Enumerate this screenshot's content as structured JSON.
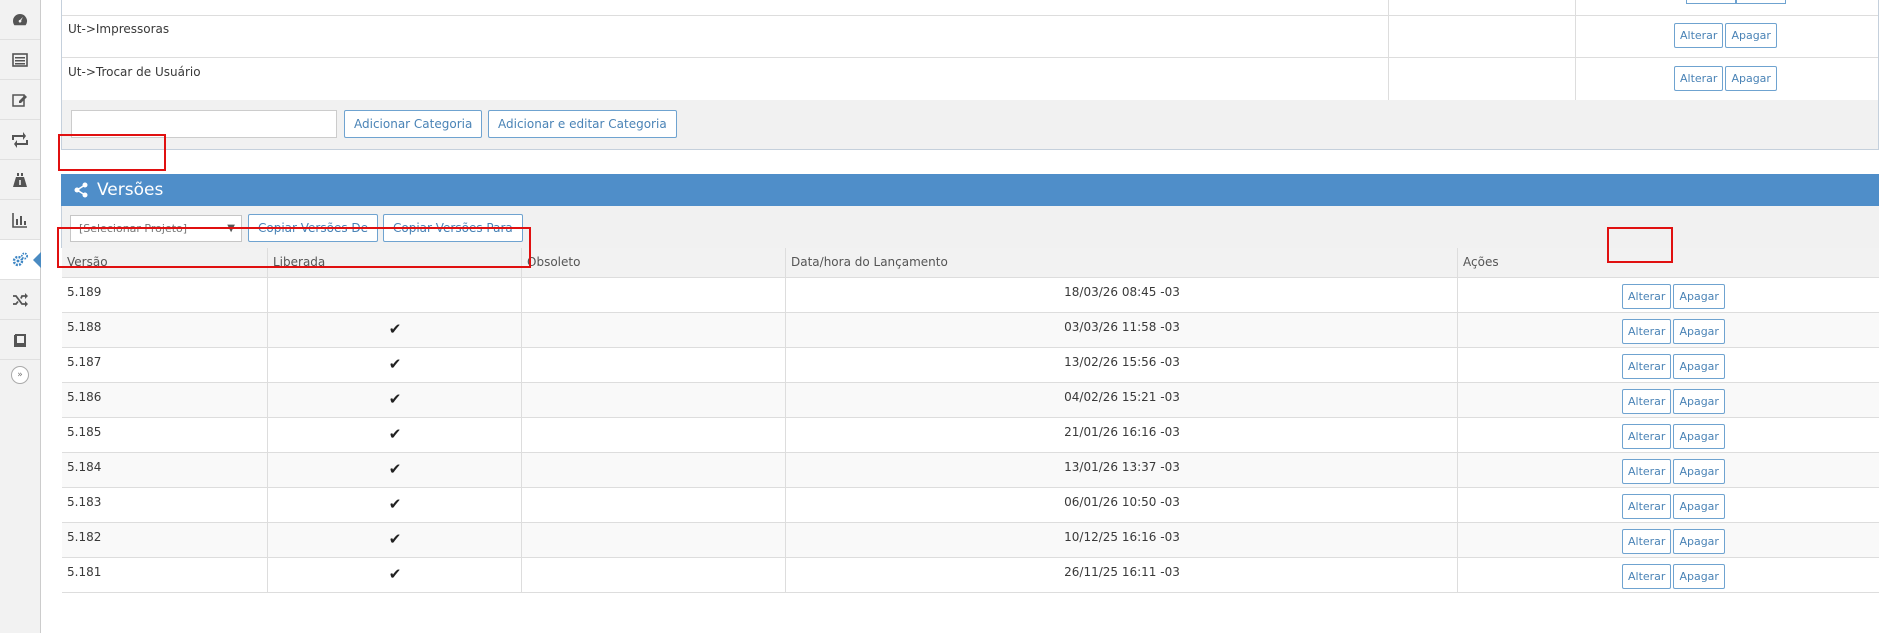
{
  "sidebar": {
    "items": [
      {
        "icon": "dashboard-icon"
      },
      {
        "icon": "list-icon"
      },
      {
        "icon": "edit-icon"
      },
      {
        "icon": "retweet-icon"
      },
      {
        "icon": "road-icon"
      },
      {
        "icon": "bar-chart-icon"
      },
      {
        "icon": "cogs-icon",
        "active": true
      },
      {
        "icon": "random-icon"
      },
      {
        "icon": "book-icon"
      }
    ],
    "collapse": "»"
  },
  "categories": {
    "rows": [
      {
        "name": "Ut->Impressoras"
      },
      {
        "name": "Ut->Trocar de Usuário"
      }
    ],
    "alterar_label": "Alterar",
    "apagar_label": "Apagar",
    "input_value": "",
    "add_label": "Adicionar Categoria",
    "add_edit_label": "Adicionar e editar Categoria"
  },
  "versions": {
    "title": "Versões",
    "project_select": "[Selecionar Projeto]",
    "copy_from_label": "Copiar Versões De",
    "copy_to_label": "Copiar Versões Para",
    "columns": {
      "versao": "Versão",
      "liberada": "Liberada",
      "obsoleto": "Obsoleto",
      "data": "Data/hora do Lançamento",
      "acoes": "Ações"
    },
    "alterar_label": "Alterar",
    "apagar_label": "Apagar",
    "check_glyph": "✔",
    "rows": [
      {
        "versao": "5.189",
        "liberada": "",
        "data": "18/03/26 08:45 -03"
      },
      {
        "versao": "5.188",
        "liberada": "✔",
        "data": "03/03/26 11:58 -03"
      },
      {
        "versao": "5.187",
        "liberada": "✔",
        "data": "13/02/26 15:56 -03"
      },
      {
        "versao": "5.186",
        "liberada": "✔",
        "data": "04/02/26 15:21 -03"
      },
      {
        "versao": "5.185",
        "liberada": "✔",
        "data": "21/01/26 16:16 -03"
      },
      {
        "versao": "5.184",
        "liberada": "✔",
        "data": "13/01/26 13:37 -03"
      },
      {
        "versao": "5.183",
        "liberada": "✔",
        "data": "06/01/26 10:50 -03"
      },
      {
        "versao": "5.182",
        "liberada": "✔",
        "data": "10/12/25 16:16 -03"
      },
      {
        "versao": "5.181",
        "liberada": "✔",
        "data": "26/11/25 16:11 -03"
      }
    ]
  }
}
